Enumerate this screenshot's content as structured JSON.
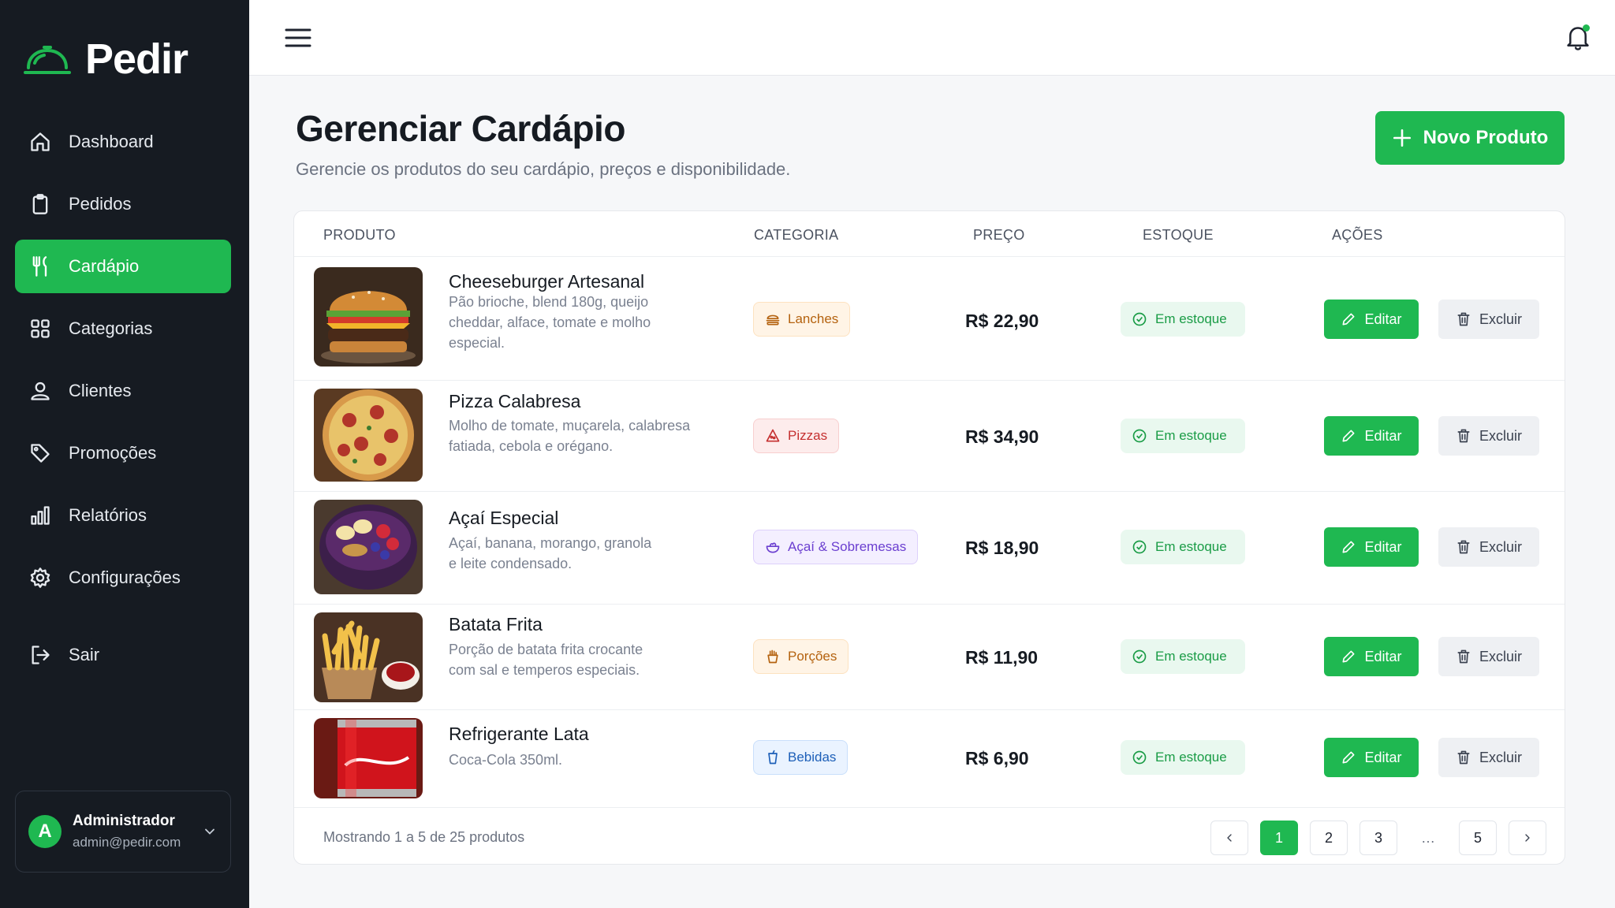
{
  "app": {
    "name": "Pedir",
    "accent": "#1fb851",
    "sidebar_bg": "#161b22"
  },
  "sidebar": {
    "items": [
      {
        "label": "Dashboard",
        "icon": "home-icon"
      },
      {
        "label": "Pedidos",
        "icon": "clipboard-icon"
      },
      {
        "label": "Cardápio",
        "icon": "utensils-icon",
        "active": true
      },
      {
        "label": "Categorias",
        "icon": "grid-icon"
      },
      {
        "label": "Clientes",
        "icon": "user-icon"
      },
      {
        "label": "Promoções",
        "icon": "tag-icon"
      },
      {
        "label": "Relatórios",
        "icon": "bar-chart-icon"
      },
      {
        "label": "Configurações",
        "icon": "gear-icon"
      }
    ],
    "logout": {
      "label": "Sair",
      "icon": "logout-icon"
    },
    "user": {
      "initial": "A",
      "name": "Administrador",
      "email": "admin@pedir.com"
    }
  },
  "header": {
    "title": "Gerenciar Cardápio",
    "subtitle": "Gerencie os produtos do seu cardápio, preços e disponibilidade.",
    "new_button": "Novo Produto"
  },
  "table": {
    "columns": [
      "PRODUTO",
      "CATEGORIA",
      "PREÇO",
      "ESTOQUE",
      "AÇÕES"
    ],
    "rows": [
      {
        "name": "Cheeseburger Artesanal",
        "desc": "Pão brioche, blend 180g, queijo cheddar, alface, tomate e molho especial.",
        "category": "Lanches",
        "price": "R$ 22,90",
        "stock": "Em estoque",
        "edit": "Editar",
        "delete": "Excluir"
      },
      {
        "name": "Pizza Calabresa",
        "desc": "Molho de tomate, muçarela, calabresa fatiada, cebola e orégano.",
        "category": "Pizzas",
        "price": "R$ 34,90",
        "stock": "Em estoque",
        "edit": "Editar",
        "delete": "Excluir"
      },
      {
        "name": "Açaí Especial",
        "desc": "Açaí, banana, morango, granola e leite condensado.",
        "category": "Açaí & Sobremesas",
        "price": "R$ 18,90",
        "stock": "Em estoque",
        "edit": "Editar",
        "delete": "Excluir"
      },
      {
        "name": "Batata Frita",
        "desc": "Porção de batata frita crocante com sal e temperos especiais.",
        "category": "Porções",
        "price": "R$ 11,90",
        "stock": "Em estoque",
        "edit": "Editar",
        "delete": "Excluir"
      },
      {
        "name": "Refrigerante Lata",
        "desc": "Coca-Cola 350ml.",
        "category": "Bebidas",
        "price": "R$ 6,90",
        "stock": "Em estoque",
        "edit": "Editar",
        "delete": "Excluir"
      }
    ],
    "footer": "Mostrando 1 a 5 de 25 produtos",
    "pagination": {
      "pages": [
        "1",
        "2",
        "3",
        "…",
        "5"
      ],
      "current": "1"
    }
  }
}
